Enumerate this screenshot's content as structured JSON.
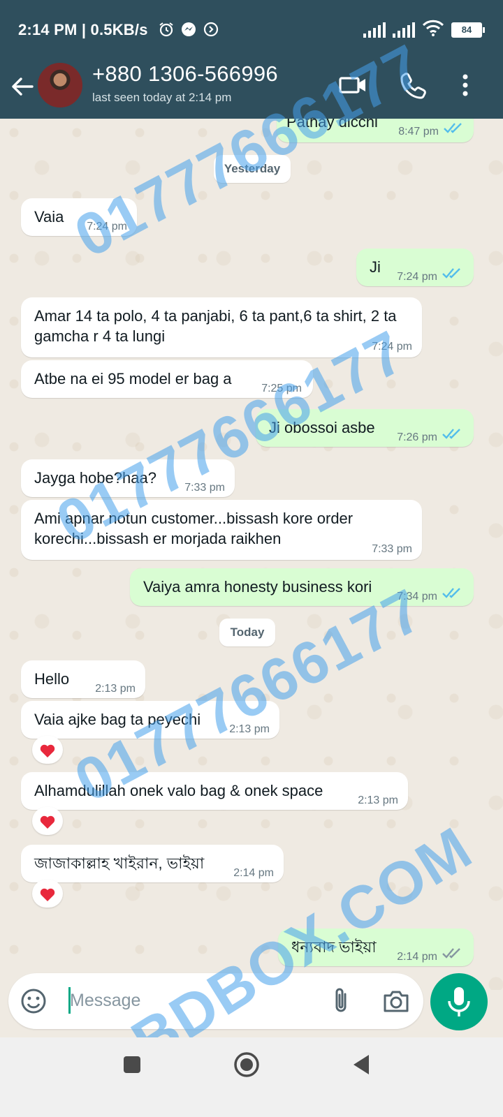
{
  "status_bar": {
    "time": "2:14 PM | 0.5KB/s",
    "battery": "84"
  },
  "header": {
    "contact_name": "+880 1306-566996",
    "last_seen": "last seen today at 2:14 pm"
  },
  "chat": {
    "messages": [
      {
        "text": "Pathay dicchi",
        "time": "8:47 pm",
        "direction": "out"
      },
      {
        "text": "Vaia",
        "time": "7:24 pm",
        "direction": "in"
      },
      {
        "text": "Ji",
        "time": "7:24 pm",
        "direction": "out"
      },
      {
        "text": "Amar 14 ta polo, 4 ta panjabi, 6 ta pant,6 ta shirt, 2 ta gamcha r 4 ta lungi",
        "time": "7:24 pm",
        "direction": "in"
      },
      {
        "text": "Atbe na ei 95 model er bag a",
        "time": "7:25 pm",
        "direction": "in"
      },
      {
        "text": "Ji obossoi asbe",
        "time": "7:26 pm",
        "direction": "out"
      },
      {
        "text": "Jayga hobe?haa?",
        "time": "7:33 pm",
        "direction": "in"
      },
      {
        "text": "Ami apnar notun customer...bissash kore order korechi...bissash er morjada raikhen",
        "time": "7:33 pm",
        "direction": "in"
      },
      {
        "text": "Vaiya amra honesty business kori",
        "time": "7:34 pm",
        "direction": "out"
      },
      {
        "text": "Hello",
        "time": "2:13 pm",
        "direction": "in"
      },
      {
        "text": "Vaia ajke bag ta peyechi",
        "time": "2:13 pm",
        "direction": "in"
      },
      {
        "text": "Alhamdulillah onek valo bag & onek space",
        "time": "2:13 pm",
        "direction": "in"
      },
      {
        "text": "জাজাকাল্লাহ খাইরান, ভাইয়া",
        "time": "2:14 pm",
        "direction": "in"
      },
      {
        "text": "ধন্যবাদ ভাইয়া",
        "time": "2:14 pm",
        "direction": "out"
      }
    ],
    "date_yesterday": "Yesterday",
    "date_today": "Today"
  },
  "input": {
    "placeholder": "Message"
  },
  "watermarks": {
    "phone": "01777666177",
    "site": "QBDBOX.COM"
  },
  "colors": {
    "header": "#2f4f5d",
    "outgoing_bubble": "#d9fdd3",
    "incoming_bubble": "#ffffff",
    "accent": "#00a884",
    "read_ticks": "#53bdeb"
  },
  "icons": [
    "back-arrow-icon",
    "video-call-icon",
    "phone-icon",
    "more-options-icon",
    "emoji-icon",
    "attach-icon",
    "camera-icon",
    "mic-icon",
    "heart-icon",
    "double-check-icon",
    "alarm-icon",
    "messenger-icon",
    "data-saver-icon",
    "signal-icon",
    "wifi-icon",
    "battery-icon",
    "nav-recents-icon",
    "nav-home-icon",
    "nav-back-icon"
  ]
}
